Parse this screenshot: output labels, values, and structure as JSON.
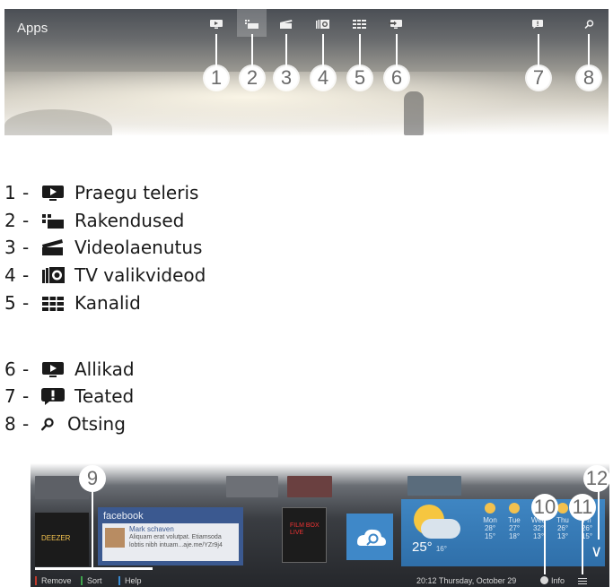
{
  "top_screen": {
    "title": "Apps",
    "toolbar_icons": [
      "tv-icon",
      "apps-icon",
      "clapper-icon",
      "catchup-icon",
      "channels-icon",
      "source-icon",
      "notification-icon",
      "search-icon"
    ],
    "active_index": 1,
    "callouts": [
      "1",
      "2",
      "3",
      "4",
      "5",
      "6",
      "7",
      "8"
    ]
  },
  "legend": {
    "separator": "-",
    "items": [
      {
        "num": "1",
        "icon": "tv-icon",
        "label": "Praegu teleris"
      },
      {
        "num": "2",
        "icon": "apps-icon",
        "label": "Rakendused"
      },
      {
        "num": "3",
        "icon": "clapper-icon",
        "label": "Videolaenutus"
      },
      {
        "num": "4",
        "icon": "catchup-icon",
        "label": "TV valikvideod"
      },
      {
        "num": "5",
        "icon": "channels-icon",
        "label": "Kanalid"
      },
      {
        "num": "6",
        "icon": "tv-icon",
        "label": "Allikad"
      },
      {
        "num": "7",
        "icon": "notification-icon",
        "label": "Teated"
      },
      {
        "num": "8",
        "icon": "search-icon",
        "label": "Otsing"
      }
    ]
  },
  "bottom_screen": {
    "facebook": {
      "title": "facebook",
      "name": "Mark schaven",
      "text": "Aliquam erat volutpat. Etiamsoda lobtis nibh intuam...aje.me/YZr9j4"
    },
    "deezer": "DEEZER",
    "filmbox": "FILM BOX LIVE",
    "weather": {
      "current": "25°",
      "current_low": "16°",
      "days": [
        {
          "day": "Mon",
          "hi": "28°",
          "lo": "15°"
        },
        {
          "day": "Tue",
          "hi": "27°",
          "lo": "18°"
        },
        {
          "day": "Wed",
          "hi": "32°",
          "lo": "13°"
        },
        {
          "day": "Thu",
          "hi": "26°",
          "lo": "13°"
        },
        {
          "day": "Fri",
          "hi": "26°",
          "lo": "15°"
        }
      ]
    },
    "actions": {
      "remove": "Remove",
      "sort": "Sort",
      "help": "Help"
    },
    "status": "20:12 Thursday, October 29",
    "info": "Info",
    "chevron": "∨",
    "callouts": {
      "c9": "9",
      "c10": "10",
      "c11": "11",
      "c12": "12"
    }
  },
  "colors": {
    "remove": "#c0392b",
    "sort": "#3fa34d",
    "help": "#3a8bd2",
    "facebook": "#3b5990"
  }
}
